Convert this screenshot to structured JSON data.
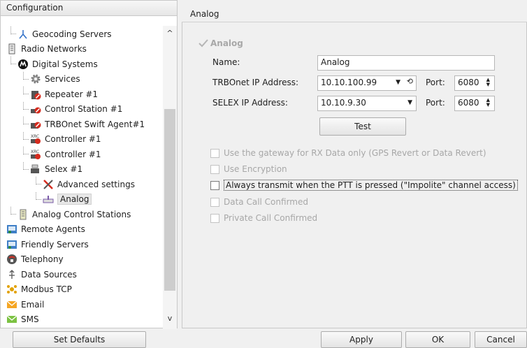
{
  "left_panel": {
    "title": "Configuration",
    "tree": [
      {
        "label": "Geocoding Servers",
        "icon": "geocoding-icon",
        "indent": 1
      },
      {
        "label": "Radio Networks",
        "icon": "radio-networks-icon",
        "indent": 0
      },
      {
        "label": "Digital Systems",
        "icon": "motorola-icon",
        "indent": 1
      },
      {
        "label": "Services",
        "icon": "gear-icon",
        "indent": 2
      },
      {
        "label": "Repeater #1",
        "icon": "repeater-icon",
        "indent": 2
      },
      {
        "label": "Control Station #1",
        "icon": "control-station-icon",
        "indent": 2
      },
      {
        "label": "TRBOnet Swift Agent#1",
        "icon": "swift-agent-icon",
        "indent": 2
      },
      {
        "label": "Controller #1",
        "icon": "controller-icon",
        "indent": 2
      },
      {
        "label": "Controller #1",
        "icon": "controller-icon",
        "indent": 2
      },
      {
        "label": "Selex #1",
        "icon": "selex-icon",
        "indent": 2
      },
      {
        "label": "Advanced settings",
        "icon": "tools-icon",
        "indent": 3
      },
      {
        "label": "Analog",
        "icon": "analog-icon",
        "indent": 3,
        "selected": true
      },
      {
        "label": "Analog Control Stations",
        "icon": "analog-stations-icon",
        "indent": 1
      },
      {
        "label": "Remote Agents",
        "icon": "remote-agents-icon",
        "indent": 0
      },
      {
        "label": "Friendly Servers",
        "icon": "friendly-servers-icon",
        "indent": 0
      },
      {
        "label": "Telephony",
        "icon": "telephony-icon",
        "indent": 0
      },
      {
        "label": "Data Sources",
        "icon": "data-sources-icon",
        "indent": 0
      },
      {
        "label": "Modbus TCP",
        "icon": "modbus-icon",
        "indent": 0
      },
      {
        "label": "Email",
        "icon": "email-icon",
        "indent": 0
      },
      {
        "label": "SMS",
        "icon": "sms-icon",
        "indent": 0
      }
    ]
  },
  "right_panel": {
    "title": "Analog",
    "group_title": "Analog",
    "name_label": "Name:",
    "name_value": "Analog",
    "trbonet_ip_label": "TRBOnet IP Address:",
    "trbonet_ip_value": "10.10.100.99",
    "selex_ip_label": "SELEX IP Address:",
    "selex_ip_value": "10.10.9.30",
    "port_label": "Port:",
    "trbonet_port": "6080",
    "selex_port": "6080",
    "test_button": "Test",
    "options": [
      {
        "label": "Use the gateway for RX Data only (GPS Revert or Data Revert)",
        "enabled": false,
        "checked": false
      },
      {
        "label": "Use Encryption",
        "enabled": false,
        "checked": false
      },
      {
        "label": "Always transmit when the PTT is pressed (\"Impolite\" channel access)",
        "enabled": true,
        "checked": false,
        "focused": true
      },
      {
        "label": "Data Call Confirmed",
        "enabled": false,
        "checked": false
      },
      {
        "label": "Private Call Confirmed",
        "enabled": false,
        "checked": false
      }
    ]
  },
  "footer": {
    "set_defaults": "Set Defaults",
    "apply": "Apply",
    "ok": "OK",
    "cancel": "Cancel"
  },
  "colors": {
    "accent_red": "#d52b1e",
    "accent_blue": "#2d6ec7",
    "disabled_text": "#a7a7a7"
  }
}
